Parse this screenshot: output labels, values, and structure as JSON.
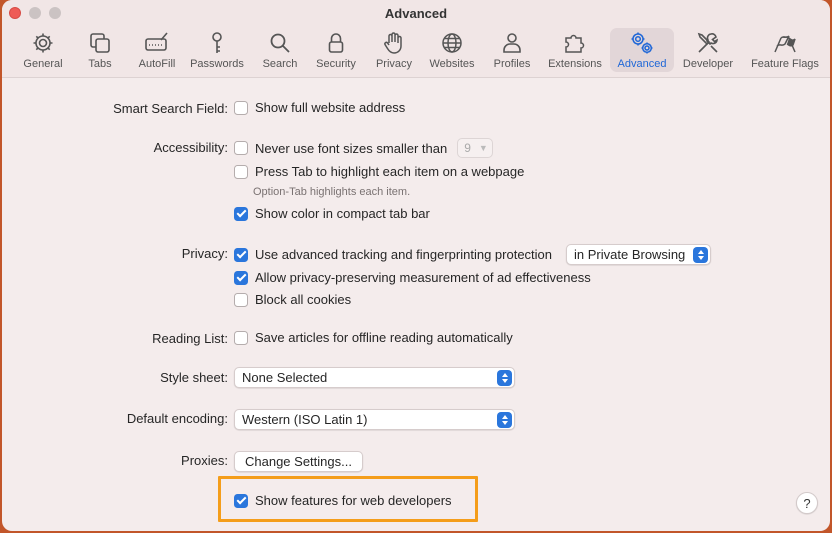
{
  "window": {
    "title": "Advanced"
  },
  "toolbar": {
    "tabs": [
      {
        "label": "General",
        "icon": "gear-icon"
      },
      {
        "label": "Tabs",
        "icon": "tabs-icon"
      },
      {
        "label": "AutoFill",
        "icon": "autofill-icon"
      },
      {
        "label": "Passwords",
        "icon": "key-icon"
      },
      {
        "label": "Search",
        "icon": "search-icon"
      },
      {
        "label": "Security",
        "icon": "lock-icon"
      },
      {
        "label": "Privacy",
        "icon": "hand-icon"
      },
      {
        "label": "Websites",
        "icon": "globe-icon"
      },
      {
        "label": "Profiles",
        "icon": "person-icon"
      },
      {
        "label": "Extensions",
        "icon": "puzzle-icon"
      },
      {
        "label": "Advanced",
        "icon": "gears-icon",
        "selected": true
      },
      {
        "label": "Developer",
        "icon": "tools-icon"
      },
      {
        "label": "Feature Flags",
        "icon": "flags-icon"
      }
    ]
  },
  "settings": {
    "smart_search": {
      "label": "Smart Search Field:",
      "show_full_address": {
        "text": "Show full website address",
        "checked": false
      }
    },
    "accessibility": {
      "label": "Accessibility:",
      "min_font": {
        "text": "Never use font sizes smaller than",
        "checked": false,
        "value": "9"
      },
      "press_tab": {
        "text": "Press Tab to highlight each item on a webpage",
        "checked": false
      },
      "hint": "Option-Tab highlights each item.",
      "compact_color": {
        "text": "Show color in compact tab bar",
        "checked": true
      }
    },
    "privacy": {
      "label": "Privacy:",
      "tracking": {
        "text": "Use advanced tracking and fingerprinting protection",
        "checked": true,
        "mode": "in Private Browsing"
      },
      "ad_measurement": {
        "text": "Allow privacy-preserving measurement of ad effectiveness",
        "checked": true
      },
      "block_cookies": {
        "text": "Block all cookies",
        "checked": false
      }
    },
    "reading_list": {
      "label": "Reading List:",
      "offline": {
        "text": "Save articles for offline reading automatically",
        "checked": false
      }
    },
    "style_sheet": {
      "label": "Style sheet:",
      "value": "None Selected"
    },
    "encoding": {
      "label": "Default encoding:",
      "value": "Western (ISO Latin 1)"
    },
    "proxies": {
      "label": "Proxies:",
      "button": "Change Settings..."
    },
    "developer": {
      "text": "Show features for web developers",
      "checked": true
    }
  },
  "help": {
    "label": "?"
  },
  "colors": {
    "accent": "#2a76dc",
    "highlight": "#f49d1a",
    "close_light": "#ee5b56"
  }
}
